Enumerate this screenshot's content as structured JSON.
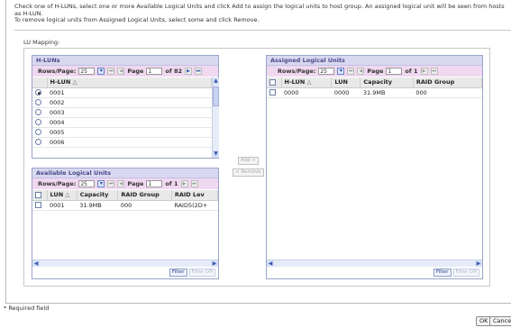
{
  "instructions": {
    "line1": "Check one of H-LUNs, select one or more Available Logical Units and click Add to assign the logical units to host group. An assigned logical unit will be seen from hosts as H-LUN.",
    "line2": "To remove logical units from Assigned Logical Units, select some and click Remove."
  },
  "lu_mapping_label": "LU Mapping:",
  "hluns": {
    "title": "H-LUNs",
    "rows_per_page_label": "Rows/Page:",
    "rows_per_page": "25",
    "page_label": "Page",
    "page_value": "1",
    "page_total": "of 82",
    "column": "H-LUN",
    "sort_icon": "△",
    "rows": [
      "0001",
      "0002",
      "0003",
      "0004",
      "0005",
      "0006"
    ]
  },
  "available": {
    "title": "Available Logical Units",
    "rows_per_page_label": "Rows/Page:",
    "rows_per_page": "25",
    "page_label": "Page",
    "page_value": "1",
    "page_total": "of 1",
    "columns": [
      "LUN",
      "Capacity",
      "RAID Group",
      "RAID Lev"
    ],
    "sort_icon": "△",
    "rows": [
      [
        "0001",
        "31.9MB",
        "000",
        "RAID5(2D+"
      ]
    ],
    "filter_label": "Filter",
    "filter_off_label": "Filter Off"
  },
  "middle": {
    "add_label": "Add >",
    "remove_label": "< Remove"
  },
  "assigned": {
    "title": "Assigned Logical Units",
    "rows_per_page_label": "Rows/Page:",
    "rows_per_page": "25",
    "page_label": "Page",
    "page_value": "1",
    "page_total": "of 1",
    "columns": [
      "H-LUN",
      "LUN",
      "Capacity",
      "RAID Group"
    ],
    "sort_icon": "△",
    "rows": [
      [
        "0000",
        "0000",
        "31.9MB",
        "000"
      ]
    ],
    "filter_label": "Filter",
    "filter_off_label": "Filter Off"
  },
  "required_note": "* Required field",
  "footer": {
    "ok_label": "OK",
    "cancel_label": "Cance"
  },
  "icons": {
    "dropdown": "chevron-down-icon",
    "first": "first-page-icon",
    "prev": "prev-page-icon",
    "next": "next-page-icon",
    "last": "last-page-icon"
  },
  "colors": {
    "title_bg": "#d9d8f0",
    "pager_bg": "#f0d8f0",
    "border": "#9aa6c8"
  }
}
